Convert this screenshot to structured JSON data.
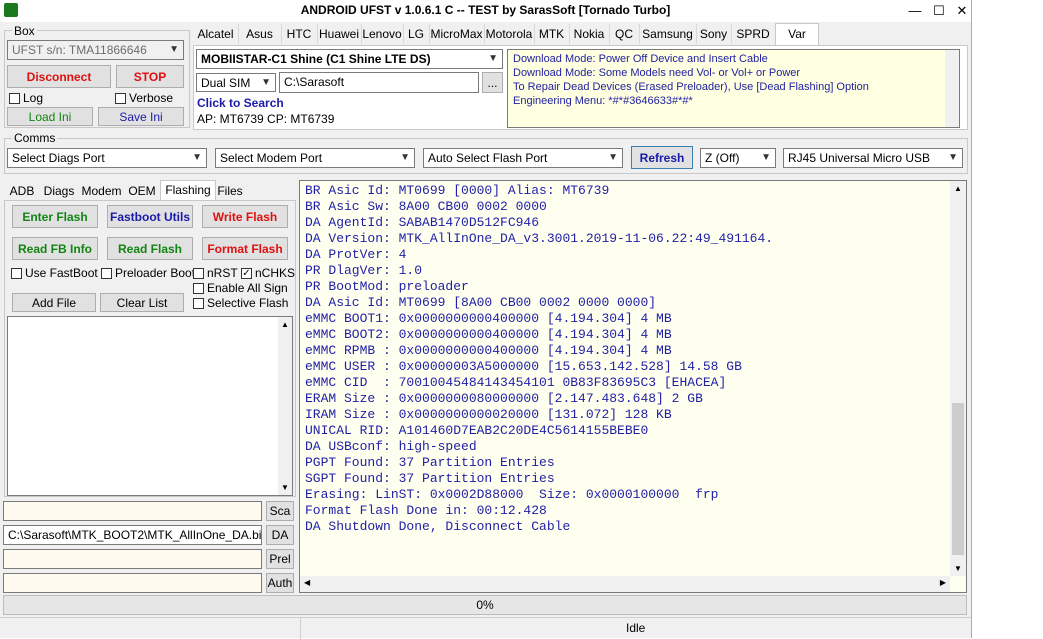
{
  "window": {
    "title": "ANDROID UFST v 1.0.6.1 C -- TEST by SarasSoft  [Tornado Turbo]",
    "minimize_glyph": "—",
    "maximize_glyph": "☐",
    "close_glyph": "✕"
  },
  "box": {
    "label": "Box",
    "serial": "UFST s/n: TMA11866646",
    "disconnect": "Disconnect",
    "stop": "STOP",
    "log": "Log",
    "verbose": "Verbose",
    "load_ini": "Load Ini",
    "save_ini": "Save Ini"
  },
  "brand_tabs": [
    "Alcatel",
    "Asus",
    "HTC",
    "Huawei",
    "Lenovo",
    "LG",
    "MicroMax",
    "Motorola",
    "MTK",
    "Nokia",
    "QC",
    "Samsung",
    "Sony",
    "SPRD",
    "Var"
  ],
  "active_brand_tab": "Var",
  "device": {
    "model": "MOBIISTAR-C1 Shine (C1 Shine LTE DS)",
    "sim": "Dual SIM",
    "path": "C:\\Sarasoft",
    "browse": "...",
    "click_to_search": "Click to Search",
    "chip_info": "AP: MT6739  CP: MT6739"
  },
  "info_lines": [
    "Download Mode: Power Off Device and Insert Cable",
    "Download Mode: Some Models need Vol- or Vol+ or Power",
    "To Repair Dead Devices (Erased Preloader), Use [Dead Flashing] Option",
    "Engineering Menu: *#*#3646633#*#*"
  ],
  "comms": {
    "label": "Comms",
    "diags_port": "Select Diags Port",
    "modem_port": "Select Modem Port",
    "flash_port": "Auto Select Flash Port",
    "refresh": "Refresh",
    "z_mode": "Z (Off)",
    "cable": "RJ45 Universal Micro USB"
  },
  "left_tabs": [
    "ADB",
    "Diags",
    "Modem",
    "OEM",
    "Flashing",
    "Files"
  ],
  "active_left_tab": "Flashing",
  "flashing": {
    "enter_flash": "Enter Flash",
    "fastboot_utils": "Fastboot Utils",
    "write_flash": "Write Flash",
    "read_fb_info": "Read FB Info",
    "read_flash": "Read Flash",
    "format_flash": "Format Flash",
    "use_fastboot": "Use FastBoot",
    "preloader_boot": "Preloader Boot",
    "nrst": "nRST",
    "nchks": "nCHKS",
    "enable_all_sign": "Enable All Sign",
    "selective_flash": "Selective Flash",
    "add_file": "Add File",
    "clear_list": "Clear List",
    "checked_nchks": true
  },
  "files": {
    "field1": "",
    "btn1": "Sca",
    "field2": "C:\\Sarasoft\\MTK_BOOT2\\MTK_AllInOne_DA.bin",
    "btn2": "DA",
    "field3": "",
    "btn3": "Prel",
    "field4": "",
    "btn4": "Auth"
  },
  "log_lines": [
    "BR Asic Id: MT0699 [0000] Alias: MT6739",
    "BR Asic Sw: 8A00 CB00 0002 0000",
    "DA AgentId: SABAB1470D512FC946",
    "DA Version: MTK_AllInOne_DA_v3.3001.2019-11-06.22:49_491164.",
    "DA ProtVer: 4",
    "PR DlagVer: 1.0",
    "PR BootMod: preloader",
    "DA Asic Id: MT0699 [8A00 CB00 0002 0000 0000]",
    "eMMC BOOT1: 0x0000000000400000 [4.194.304] 4 MB",
    "eMMC BOOT2: 0x0000000000400000 [4.194.304] 4 MB",
    "eMMC RPMB : 0x0000000000400000 [4.194.304] 4 MB",
    "eMMC USER : 0x00000003A5000000 [15.653.142.528] 14.58 GB",
    "eMMC CID  : 70010045484143454101 0B83F83695C3 [EHACEA]",
    "ERAM Size : 0x0000000080000000 [2.147.483.648] 2 GB",
    "IRAM Size : 0x0000000000020000 [131.072] 128 KB",
    "UNICAL RID: A101460D7EAB2C20DE4C5614155BEBE0",
    "DA USBconf: high-speed",
    "PGPT Found: 37 Partition Entries",
    "SGPT Found: 37 Partition Entries",
    "Erasing: LinST: 0x0002D88000  Size: 0x0000100000  frp",
    "Format Flash Done in: 00:12.428",
    "DA Shutdown Done, Disconnect Cable"
  ],
  "progress": {
    "text": "0%",
    "value": 0
  },
  "status": "Idle",
  "colors": {
    "red": "#e01010",
    "green": "#128412",
    "blue": "#1a1aa8",
    "log_text": "#1f1fa6"
  }
}
